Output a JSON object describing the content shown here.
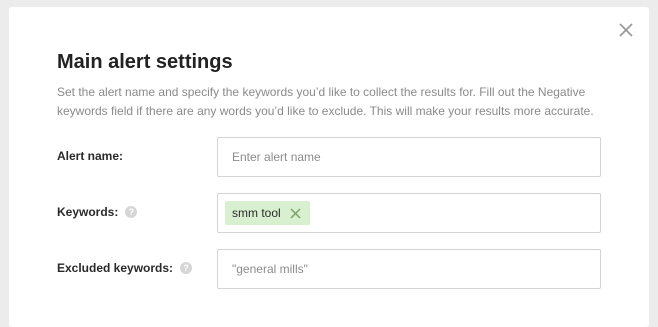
{
  "dialog": {
    "title": "Main alert settings",
    "description": "Set the alert name and specify the keywords you’d like to collect the results for. Fill out the Negative keywords field if there are any words you’d like to exclude. This will make your results more accurate.",
    "close_icon": "close-icon"
  },
  "form": {
    "alert_name": {
      "label": "Alert name:",
      "value": "",
      "placeholder": "Enter alert name"
    },
    "keywords": {
      "label": "Keywords:",
      "help_icon": "question-circle-icon",
      "help_glyph": "?",
      "tags": [
        {
          "text": "smm tool",
          "remove_icon": "close-icon"
        }
      ]
    },
    "excluded_keywords": {
      "label": "Excluded keywords:",
      "help_icon": "question-circle-icon",
      "help_glyph": "?",
      "value": "",
      "placeholder": "\"general mills\""
    }
  },
  "colors": {
    "tag_background": "#d8f0cf",
    "tag_remove": "#7aa26a",
    "border": "#d3d3d3",
    "title": "#222222",
    "description": "#8a8a8a"
  }
}
